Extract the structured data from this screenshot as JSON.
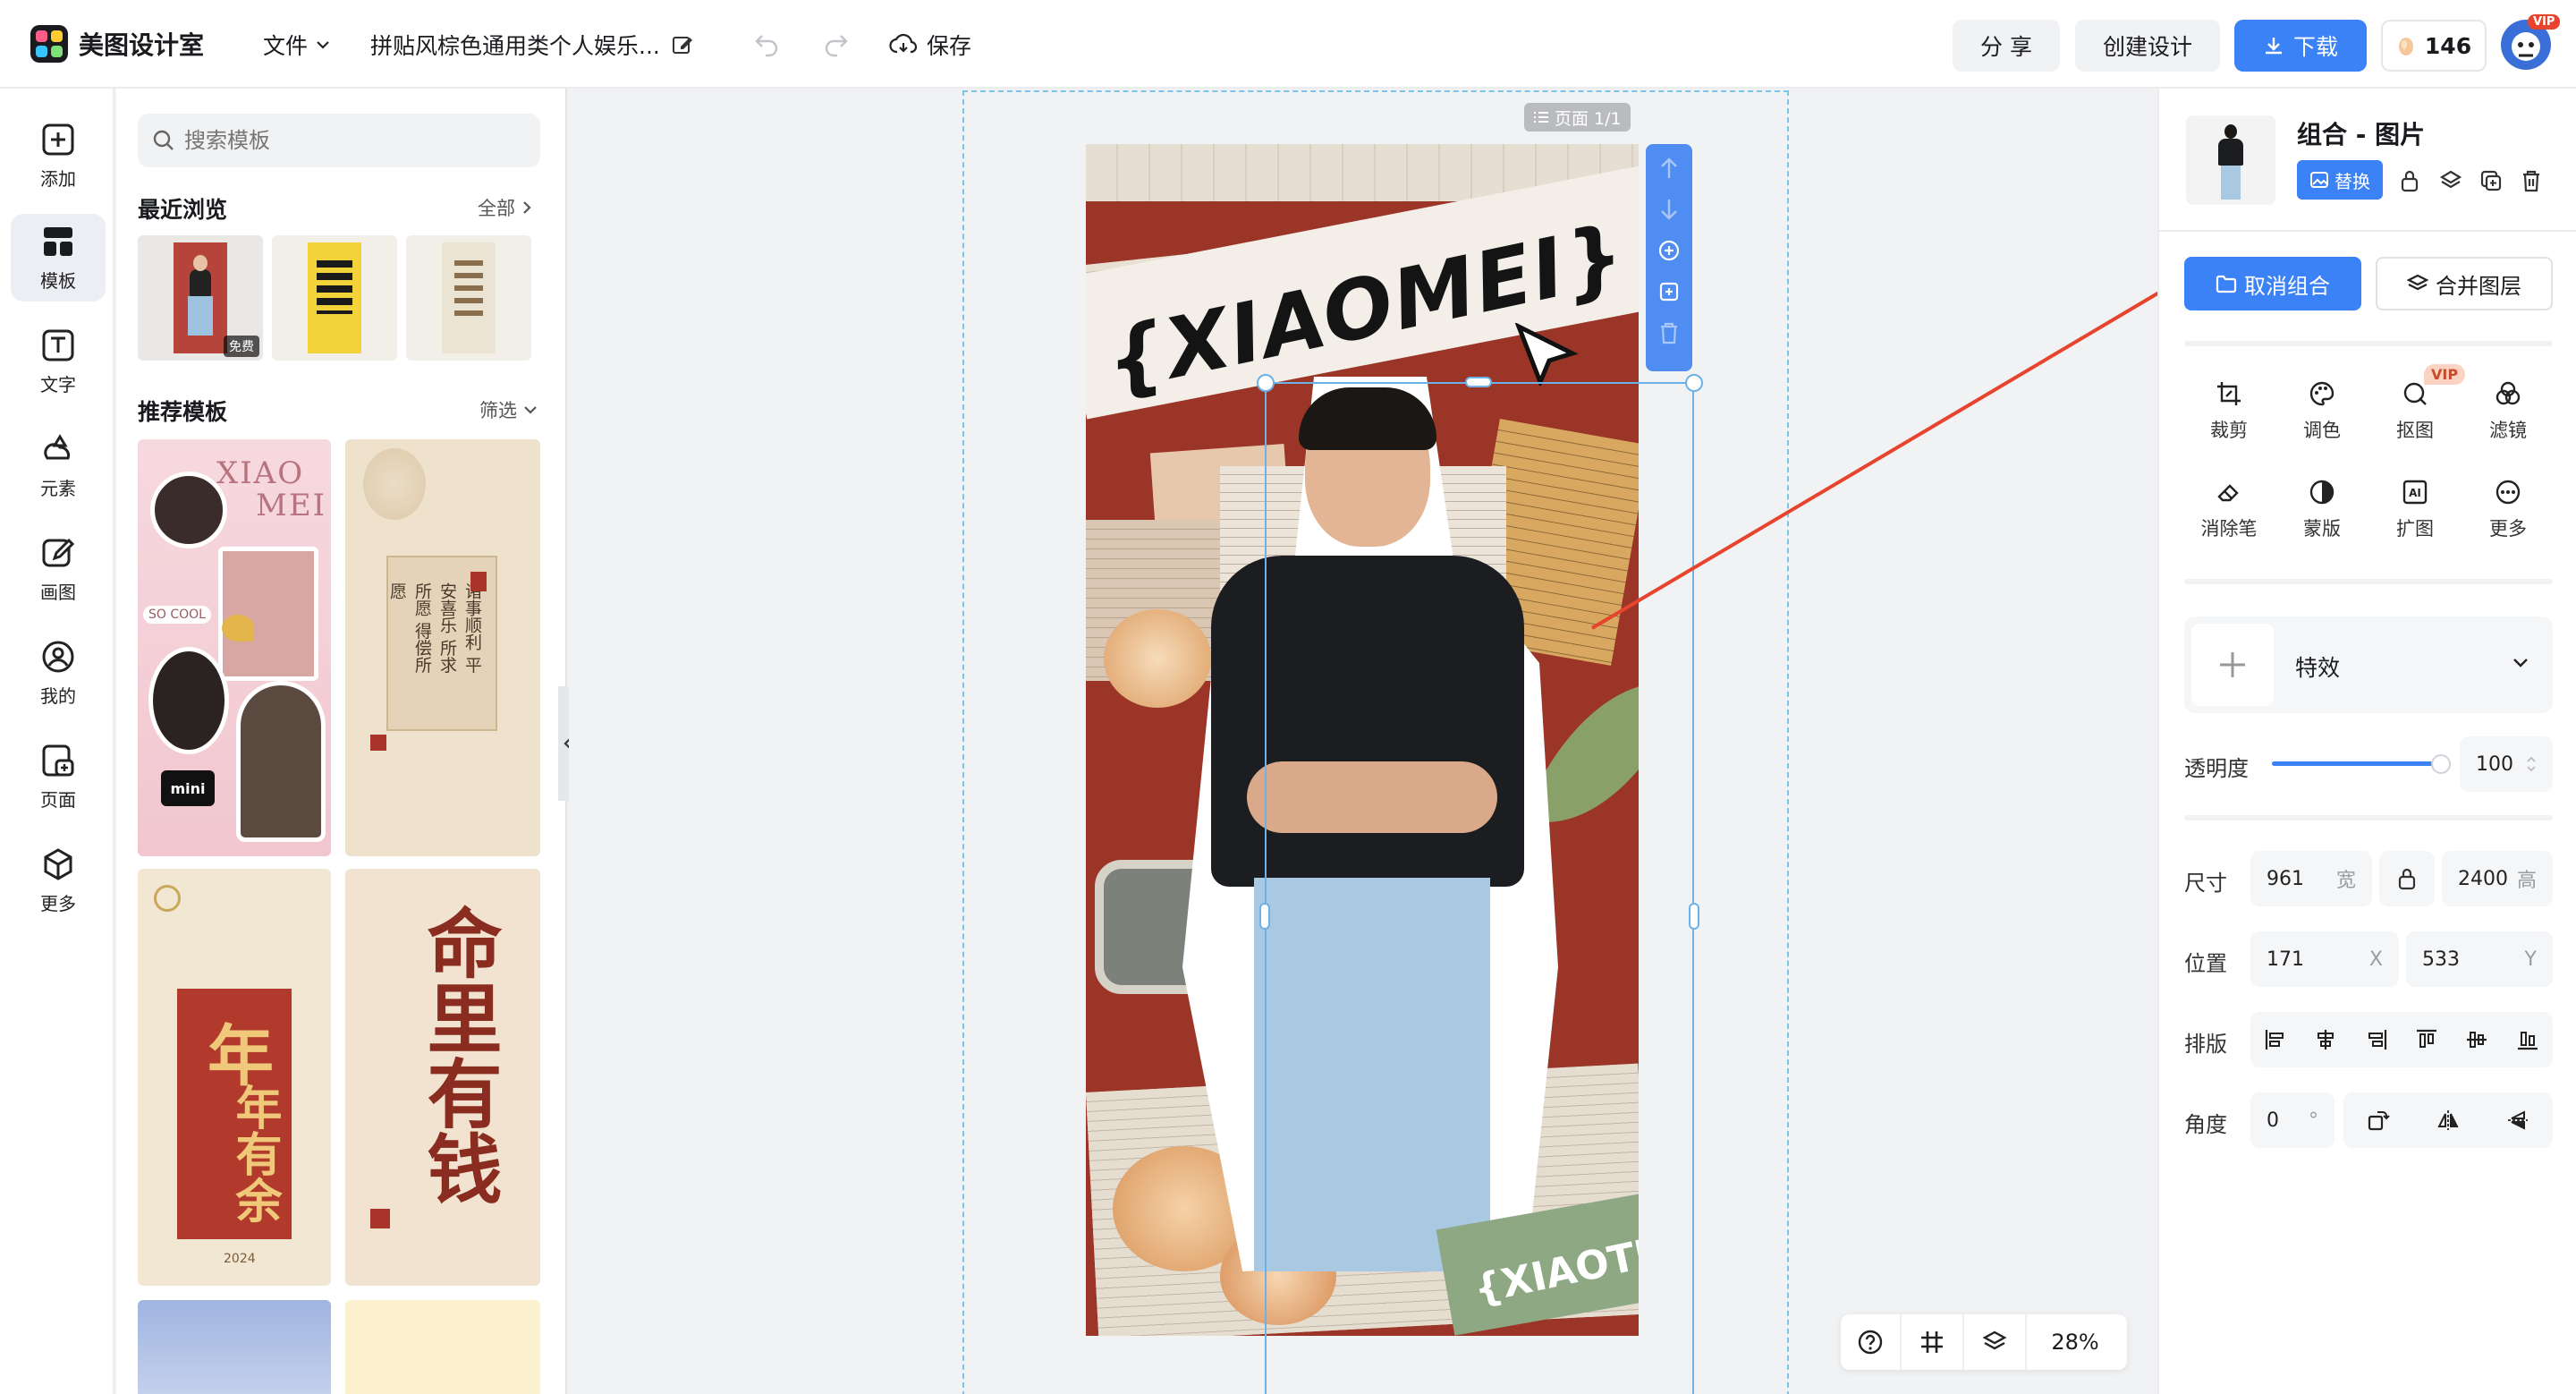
{
  "topbar": {
    "app_name": "美图设计室",
    "file_menu": "文件",
    "doc_title": "拼贴风棕色通用类个人娱乐...",
    "save_label": "保存",
    "share_label": "分 享",
    "create_label": "创建设计",
    "download_label": "下载",
    "credits": "146",
    "vip_badge": "VIP"
  },
  "leftnav": [
    {
      "label": "添加",
      "icon": "plus-square-icon"
    },
    {
      "label": "模板",
      "icon": "template-icon"
    },
    {
      "label": "文字",
      "icon": "text-icon"
    },
    {
      "label": "元素",
      "icon": "shapes-icon"
    },
    {
      "label": "画图",
      "icon": "pencil-icon"
    },
    {
      "label": "我的",
      "icon": "user-icon"
    },
    {
      "label": "页面",
      "icon": "page-add-icon"
    },
    {
      "label": "更多",
      "icon": "cube-icon"
    }
  ],
  "panel": {
    "search_placeholder": "搜索模板",
    "recent_title": "最近浏览",
    "recent_all": "全部",
    "free_badge": "免费",
    "recommend_title": "推荐模板",
    "filter_label": "筛选",
    "templates": [
      {
        "title_line1": "XIAO",
        "title_line2": "MEI",
        "tag": "SO COOL"
      },
      {
        "poem": "诸事顺利 平安喜乐 所求所愿 得偿所愿"
      },
      {
        "big1": "年",
        "big2": "年有余",
        "year": "2024"
      },
      {
        "big": "命里有钱"
      }
    ]
  },
  "canvas": {
    "page_label": "页面 1/1",
    "zoom": "28%",
    "poster_title": "{XIAOMEI}",
    "poster_tag": "{XIAOTU}"
  },
  "rightpanel": {
    "title": "组合 - 图片",
    "replace_label": "替换",
    "ungroup_label": "取消组合",
    "merge_label": "合并图层",
    "tools": [
      {
        "label": "裁剪",
        "icon": "crop-icon"
      },
      {
        "label": "调色",
        "icon": "palette-icon"
      },
      {
        "label": "抠图",
        "icon": "cutout-icon",
        "badge": "VIP"
      },
      {
        "label": "滤镜",
        "icon": "filter-icon"
      },
      {
        "label": "消除笔",
        "icon": "eraser-icon"
      },
      {
        "label": "蒙版",
        "icon": "mask-icon"
      },
      {
        "label": "扩图",
        "icon": "expand-icon"
      },
      {
        "label": "更多",
        "icon": "more-icon"
      }
    ],
    "effects_label": "特效",
    "opacity_label": "透明度",
    "opacity_value": "100",
    "opacity_percent": 100,
    "size_label": "尺寸",
    "width_value": "961",
    "width_suffix": "宽",
    "height_value": "2400",
    "height_suffix": "高",
    "position_label": "位置",
    "x_value": "171",
    "x_suffix": "X",
    "y_value": "533",
    "y_suffix": "Y",
    "arrange_label": "排版",
    "angle_label": "角度",
    "angle_value": "0",
    "angle_suffix": "°"
  },
  "colors": {
    "accent": "#3b82f6",
    "annotation_red": "#e8432d",
    "poster_red": "#9b3527"
  }
}
